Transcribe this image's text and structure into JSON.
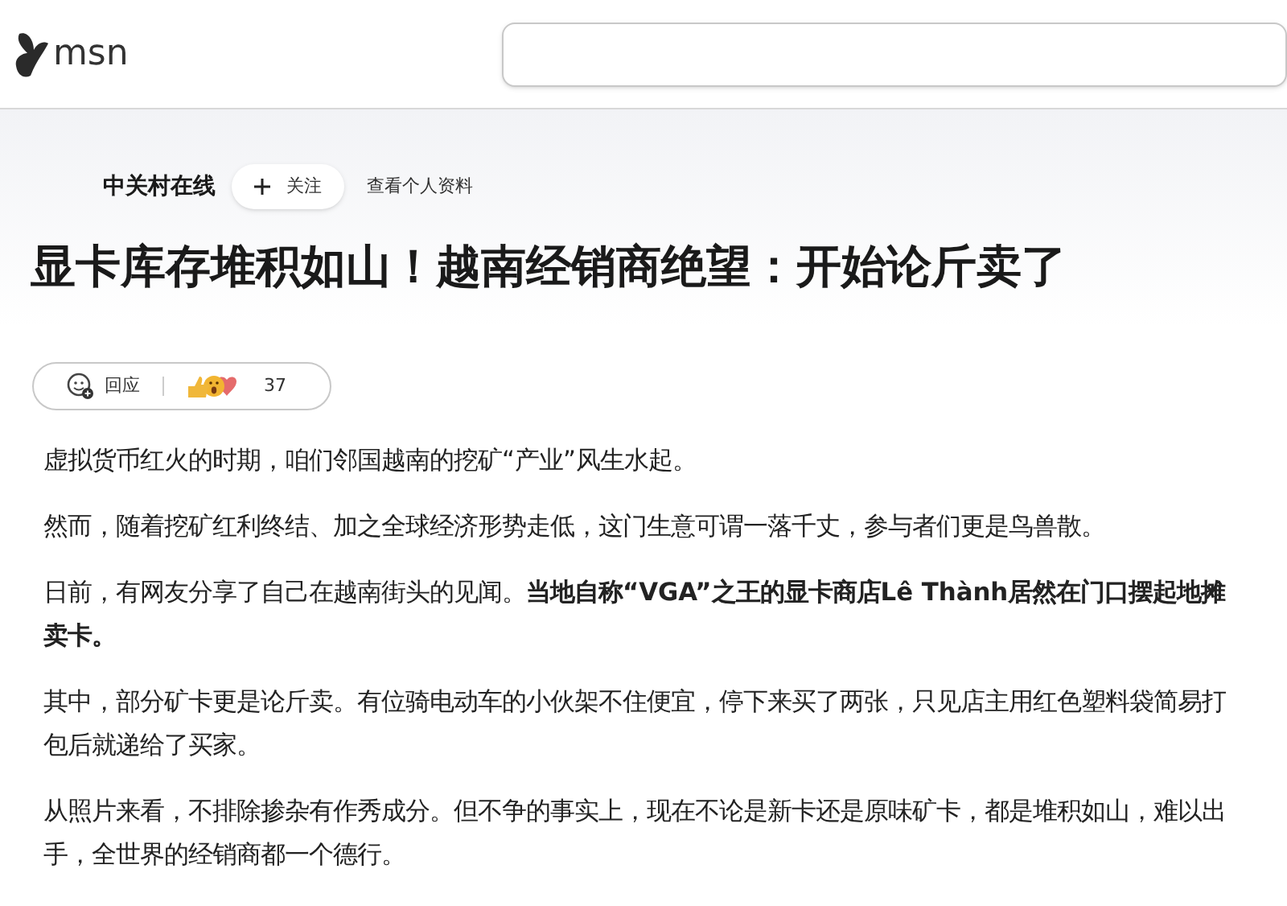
{
  "header": {
    "logo_text": "msn"
  },
  "article": {
    "source": "中关村在线",
    "follow_button": "关注",
    "profile_link": "查看个人资料",
    "title": "显卡库存堆积如山！越南经销商绝望：开始论斤卖了",
    "reaction_bar": {
      "respond_label": "回应",
      "count": "37"
    },
    "paragraphs": [
      "虚拟货币红火的时期，咱们邻国越南的挖矿“产业”风生水起。",
      "然而，随着挖矿红利终结、加之全球经济形势走低，这门生意可谓一落千丈，参与者们更是鸟兽散。",
      "日前，有网友分享了自己在越南街头的见闻。**当地自称“VGA”之王的显卡商店Lê Thành居然在门口摆起地摊卖卡。**",
      "其中，部分矿卡更是论斤卖。有位骑电动车的小伙架不住便宜，停下来买了两张，只见店主用红色塑料袋简易打包后就递给了买家。",
      "从照片来看，不排除掺杂有作秀成分。但不争的事实上，现在不论是新卡还是原味矿卡，都是堆积如山，难以出手，全世界的经销商都一个德行。"
    ]
  }
}
